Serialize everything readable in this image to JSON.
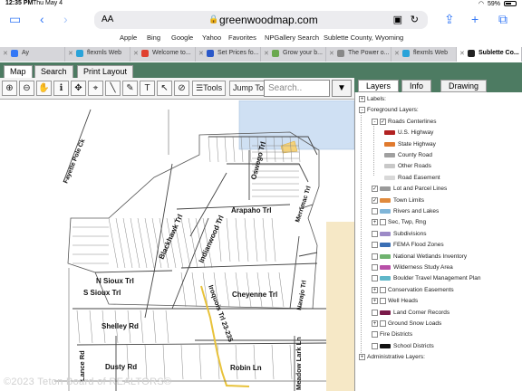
{
  "status": {
    "time": "12:35 PM",
    "day": "Thu May 4",
    "battery": "59%"
  },
  "browser": {
    "text_size_label": "AA",
    "url": "greenwoodmap.com"
  },
  "bookmarks": [
    "Apple",
    "Bing",
    "Google",
    "Yahoo",
    "Favorites",
    "NPGallery Search",
    "Sublette County, Wyoming"
  ],
  "tabs": [
    {
      "title": "Ay",
      "color": "#3478f6"
    },
    {
      "title": "flexmls Web",
      "color": "#2aa3d9"
    },
    {
      "title": "Welcome to...",
      "color": "#e0402f"
    },
    {
      "title": "Set Prices fo...",
      "color": "#2a58c9"
    },
    {
      "title": "Grow your b...",
      "color": "#6aa84f"
    },
    {
      "title": "The Power o...",
      "color": "#888888"
    },
    {
      "title": "flexmls Web",
      "color": "#2aa3d9"
    },
    {
      "title": "Sublette Co...",
      "color": "#222222"
    }
  ],
  "app_tabs": [
    "Map",
    "Search",
    "Print Layout"
  ],
  "tools": {
    "tools_label": "Tools",
    "jump_label": "Jump To",
    "search_placeholder": "Search..",
    "search_btn": "▼"
  },
  "map": {
    "watermark": "©2023 Teton Board of REALTORS®",
    "labels": {
      "fayette": "Fayette Pole Ck",
      "oswego": "Oswego Trl",
      "blackhawk": "Blackhawk Trl",
      "arapaho": "Arapaho Trl",
      "merrimac": "Merrimac Trl",
      "indianwood": "Indianwood Trl",
      "nsioux": "N Sioux Trl",
      "navajo": "Navajo Trl",
      "ssioux": "S Sioux Trl",
      "cheyenne": "Cheyenne Trl",
      "iroquois": "Iroquois Trl 23-235",
      "shelley": "Shelley Rd",
      "lance": "Lance Rd",
      "meadowlark": "Meadow Lark Ln",
      "dusty": "Dusty Rd",
      "robin": "Robin Ln"
    }
  },
  "panel": {
    "tabs": [
      "Layers",
      "Info",
      "Drawing"
    ],
    "rows": [
      {
        "label": "Labels:",
        "ctl": "+",
        "cb": false,
        "indent": 0
      },
      {
        "label": "Foreground Layers:",
        "ctl": "-",
        "cb": false,
        "indent": 0
      },
      {
        "label": "Roads Centerlines",
        "ctl": "-",
        "cb": true,
        "checked": true,
        "indent": 1
      },
      {
        "label": "U.S. Highway",
        "swatch": "#b22222",
        "indent": 2
      },
      {
        "label": "State Highway",
        "swatch": "#e07a2e",
        "indent": 2
      },
      {
        "label": "County Road",
        "swatch": "#a0a0a0",
        "indent": 2
      },
      {
        "label": "Other Roads",
        "swatch": "#c8c8c8",
        "indent": 2
      },
      {
        "label": "Road Easement",
        "swatch": "#d8d8d8",
        "indent": 2
      },
      {
        "label": "Lot and Parcel Lines",
        "cb": true,
        "checked": true,
        "swatch": "#9a9a9a",
        "indent": 1
      },
      {
        "label": "Town Limits",
        "cb": true,
        "checked": true,
        "swatch": "#e08a3c",
        "indent": 1
      },
      {
        "label": "Rivers and Lakes",
        "cb": true,
        "checked": false,
        "swatch": "#7fb5d8",
        "indent": 1
      },
      {
        "label": "Sec, Twp, Rng",
        "ctl": "+",
        "cb": true,
        "checked": false,
        "indent": 1
      },
      {
        "label": "Subdivisions",
        "cb": true,
        "checked": false,
        "swatch": "#9c8ac7",
        "indent": 1
      },
      {
        "label": "FEMA Flood Zones",
        "cb": true,
        "checked": false,
        "swatch": "#3a6fb5",
        "indent": 1
      },
      {
        "label": "National Wetlands Inventory",
        "cb": true,
        "checked": false,
        "swatch": "#6fb36f",
        "indent": 1
      },
      {
        "label": "Wilderness Study Area",
        "cb": true,
        "checked": false,
        "swatch": "#b84fa8",
        "indent": 1
      },
      {
        "label": "Boulder Travel Management Plan",
        "cb": true,
        "checked": false,
        "swatch": "#5fb7c9",
        "indent": 1
      },
      {
        "label": "Conservation Easements",
        "ctl": "+",
        "cb": true,
        "checked": false,
        "indent": 1
      },
      {
        "label": "Well Heads",
        "ctl": "+",
        "cb": true,
        "checked": false,
        "indent": 1
      },
      {
        "label": "Land Corner Records",
        "cb": true,
        "checked": false,
        "swatch": "#7a1a4a",
        "indent": 1
      },
      {
        "label": "Ground Snow Loads",
        "ctl": "+",
        "cb": true,
        "checked": false,
        "indent": 1
      },
      {
        "label": "Fire Districts",
        "cb": true,
        "checked": false,
        "indent": 1
      },
      {
        "label": "School Districts",
        "cb": true,
        "checked": false,
        "swatch": "#111111",
        "indent": 1
      },
      {
        "label": "Administrative Layers:",
        "ctl": "+",
        "cb": false,
        "indent": 0
      }
    ]
  }
}
